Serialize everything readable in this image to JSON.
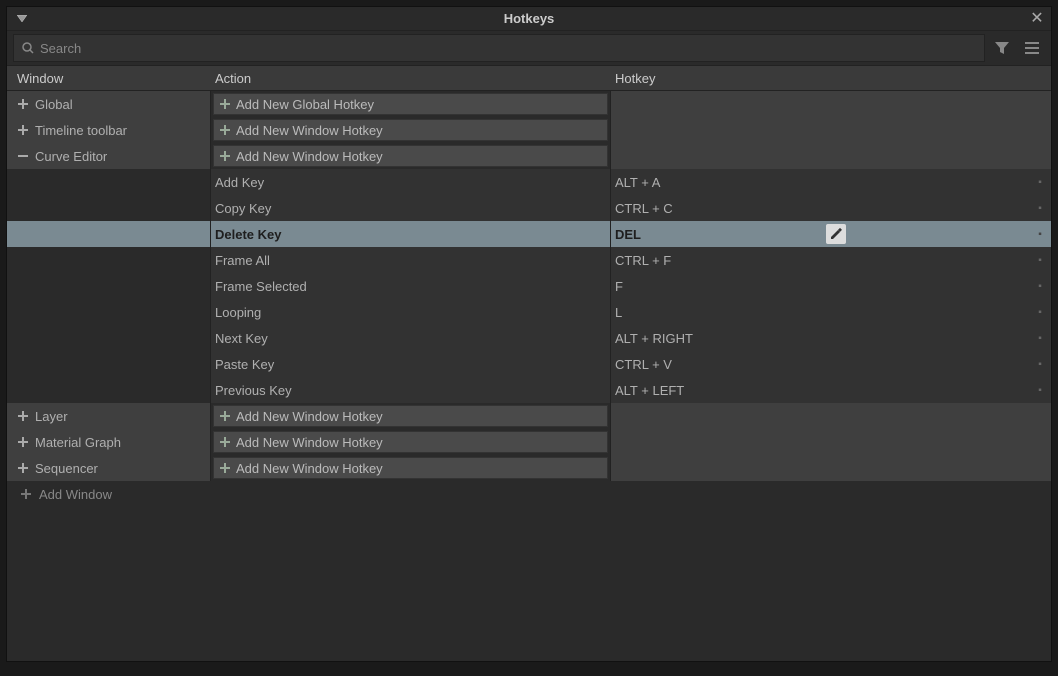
{
  "window": {
    "title": "Hotkeys"
  },
  "search": {
    "placeholder": "Search"
  },
  "columns": {
    "window": "Window",
    "action": "Action",
    "hotkey": "Hotkey"
  },
  "labels": {
    "add_global": "Add New Global Hotkey",
    "add_window": "Add New Window Hotkey",
    "add_window_row": "Add Window"
  },
  "groups": [
    {
      "name": "Global",
      "expanded": false,
      "add_label_key": "add_global",
      "children": []
    },
    {
      "name": "Timeline toolbar",
      "expanded": false,
      "add_label_key": "add_window",
      "children": []
    },
    {
      "name": "Curve Editor",
      "expanded": true,
      "add_label_key": "add_window",
      "children": [
        {
          "action": "Add Key",
          "hotkey": "ALT + A",
          "selected": false
        },
        {
          "action": "Copy Key",
          "hotkey": "CTRL + C",
          "selected": false
        },
        {
          "action": "Delete Key",
          "hotkey": "DEL",
          "selected": true
        },
        {
          "action": "Frame All",
          "hotkey": "CTRL + F",
          "selected": false
        },
        {
          "action": "Frame Selected",
          "hotkey": "F",
          "selected": false
        },
        {
          "action": "Looping",
          "hotkey": "L",
          "selected": false
        },
        {
          "action": "Next Key",
          "hotkey": "ALT + RIGHT",
          "selected": false
        },
        {
          "action": "Paste Key",
          "hotkey": "CTRL + V",
          "selected": false
        },
        {
          "action": "Previous Key",
          "hotkey": "ALT + LEFT",
          "selected": false
        }
      ]
    },
    {
      "name": "Layer",
      "expanded": false,
      "add_label_key": "add_window",
      "children": []
    },
    {
      "name": "Material Graph",
      "expanded": false,
      "add_label_key": "add_window",
      "children": []
    },
    {
      "name": "Sequencer",
      "expanded": false,
      "add_label_key": "add_window",
      "children": []
    }
  ]
}
